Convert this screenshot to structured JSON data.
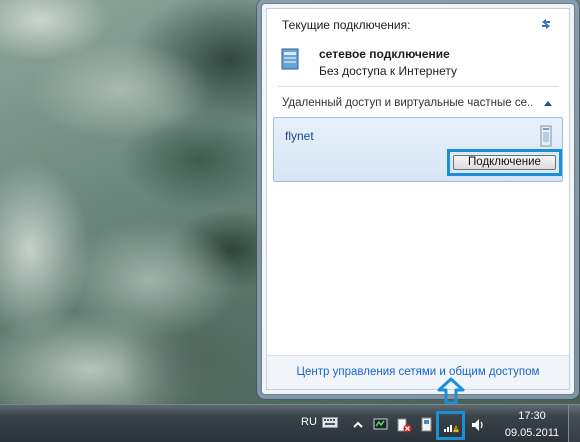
{
  "flyout": {
    "current_connections_title": "Текущие подключения:",
    "network": {
      "name": "сетевое подключение",
      "status": "Без доступа к Интернету"
    },
    "section_title": "Удаленный доступ и виртуальные частные се...",
    "vpn": {
      "name": "flynet",
      "connect_label": "Подключение"
    },
    "footer_link": "Центр управления сетями и общим доступом"
  },
  "taskbar": {
    "language": "RU",
    "time": "17:30",
    "date": "09.05.2011"
  },
  "colors": {
    "highlight": "#1a8fd6",
    "link": "#1665c8",
    "vpn_selected_bg": "#d7e6f6"
  },
  "icons": {
    "refresh": "refresh-icon",
    "network": "network-icon",
    "vpn": "vpn-icon",
    "chevron": "chevron-up-icon",
    "keyboard": "keyboard-icon",
    "tray_network": "network-tray-icon",
    "volume": "volume-icon"
  }
}
